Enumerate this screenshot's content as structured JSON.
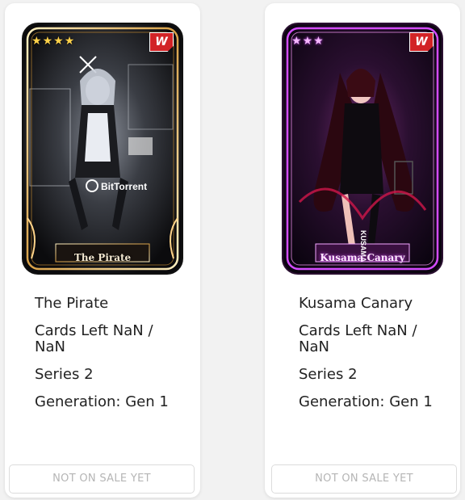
{
  "colors": {
    "page_bg": "#f2f2f2",
    "panel_bg": "#ffffff",
    "text": "#222222",
    "button_text": "#b5b5b5",
    "gold_frame": "#e6b65a",
    "purple_frame": "#d44bff",
    "badge_red": "#d22326"
  },
  "cards": [
    {
      "name": "The Pirate",
      "stars": [
        "★",
        "★",
        "★",
        "★"
      ],
      "badge": "W",
      "art_caption": "BitTorrent",
      "title": "The Pirate",
      "cards_left": "Cards Left NaN / NaN",
      "series": "Series 2",
      "generation": "Generation: Gen 1",
      "button": "NOT ON SALE YET"
    },
    {
      "name": "Kusama Canary",
      "stars": [
        "★",
        "★",
        "★"
      ],
      "badge": "W",
      "art_caption": "KUSAMA",
      "title": "Kusama Canary",
      "cards_left": "Cards Left NaN / NaN",
      "series": "Series 2",
      "generation": "Generation: Gen 1",
      "button": "NOT ON SALE YET"
    }
  ]
}
